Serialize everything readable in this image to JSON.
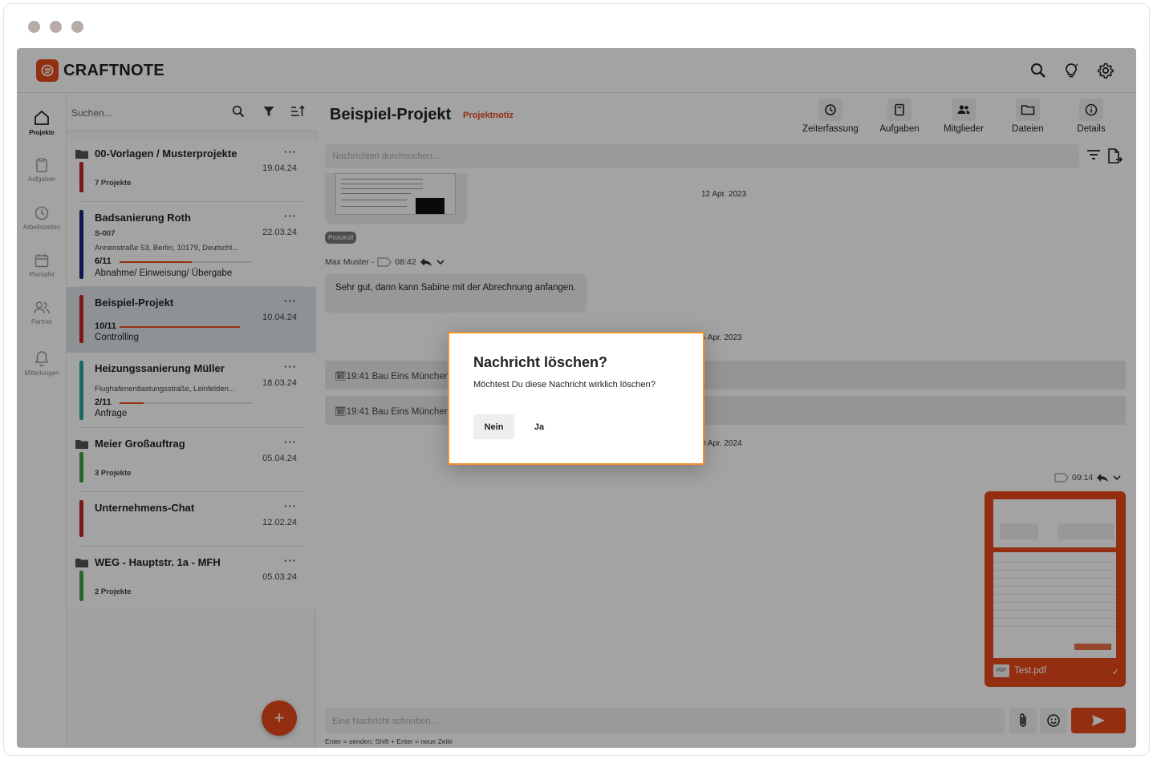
{
  "app": {
    "name": "CRAFTNOTE"
  },
  "nav": {
    "items": [
      {
        "label": "Projekte",
        "icon": "home-icon",
        "active": true
      },
      {
        "label": "Aufgaben",
        "icon": "clipboard-icon"
      },
      {
        "label": "Arbeitszeiten",
        "icon": "clock-icon"
      },
      {
        "label": "Plantafel",
        "icon": "calendar-icon"
      },
      {
        "label": "Partner",
        "icon": "people-icon"
      },
      {
        "label": "Mitteilungen",
        "icon": "bell-icon"
      }
    ]
  },
  "projects": {
    "search_placeholder": "Suchen...",
    "items": [
      {
        "title": "00-Vorlagen / Musterprojekte",
        "date": "19.04.24",
        "sub": "7 Projekte",
        "color": "#c62828",
        "folder": true
      },
      {
        "title": "Badsanierung Roth",
        "date": "22.03.24",
        "code": "S-007",
        "address": "Annenstraße 53, Berlin, 10179, Deutschl...",
        "progress_label": "6/11",
        "progress": 0.55,
        "phase": "Abnahme/ Einweisung/ Übergabe",
        "color": "#1a237e"
      },
      {
        "title": "Beispiel-Projekt",
        "date": "10.04.24",
        "progress_label": "10/11",
        "progress": 0.91,
        "phase": "Controlling",
        "color": "#c62828",
        "selected": true
      },
      {
        "title": "Heizungssanierung Müller",
        "date": "18.03.24",
        "address": "Flughafenentlastungsstraße, Leinfelden...",
        "progress_label": "2/11",
        "progress": 0.18,
        "phase": "Anfrage",
        "color": "#26a69a"
      },
      {
        "title": "Meier Großauftrag",
        "date": "05.04.24",
        "sub": "3 Projekte",
        "color": "#43a047",
        "folder": true
      },
      {
        "title": "Unternehmens-Chat",
        "date": "12.02.24",
        "color": "#c62828"
      },
      {
        "title": "WEG - Hauptstr. 1a - MFH",
        "date": "05.03.24",
        "sub": "2 Projekte",
        "color": "#43a047",
        "folder": true
      }
    ]
  },
  "chat": {
    "title": "Beispiel-Projekt",
    "badge": "Projektnotiz",
    "header_buttons": [
      "Zeiterfassung",
      "Aufgaben",
      "Mitglieder",
      "Dateien",
      "Details"
    ],
    "search_placeholder": "Nachrichten durchsuchen...",
    "date1": "12 Apr. 2023",
    "chip": "Protokoll",
    "author": "Max Muster -",
    "time1": "08:42",
    "message1": "Sehr gut, dann kann Sabine mit der Abrechnung anfangen.",
    "date2": "5 Apr. 2023",
    "system1": "19:41 Bau Eins München",
    "system2": "19:41 Bau Eins München",
    "date3": "0 Apr. 2024",
    "time2": "09:14",
    "file_name": "Test.pdf",
    "file_tag": "PDF",
    "composer_placeholder": "Eine Nachricht schreiben...",
    "hint": "Enter = senden; Shift + Enter = neue Zeile"
  },
  "dialog": {
    "title": "Nachricht löschen?",
    "text": "Möchtest Du diese Nachricht wirklich löschen?",
    "no": "Nein",
    "yes": "Ja"
  },
  "colors": {
    "accent": "#e64a19",
    "dialog_border": "#f4902a"
  }
}
